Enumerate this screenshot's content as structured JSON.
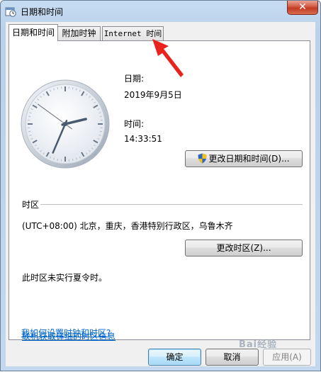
{
  "window": {
    "title": "日期和时间",
    "close_label": "✕"
  },
  "tabs": [
    {
      "label": "日期和时间",
      "active": true
    },
    {
      "label": "附加时钟",
      "active": false
    },
    {
      "label": "Internet 时间",
      "active": false
    }
  ],
  "date": {
    "label": "日期:",
    "value": "2019年9月5日"
  },
  "time": {
    "label": "时间:",
    "value": "14:33:51"
  },
  "clock": {
    "hour": 14,
    "minute": 33,
    "second": 51
  },
  "change_datetime_button": "更改日期和时间(D)...",
  "timezone": {
    "section_label": "时区",
    "value": "(UTC+08:00) 北京，重庆，香港特别行政区，乌鲁木齐",
    "change_button": "更改时区(Z)...",
    "dst_note": "此时区未实行夏令时。"
  },
  "links": {
    "timezone_info": "联机获取详细的时区信息",
    "how_to": "我如何设置时钟和时区?"
  },
  "footer": {
    "ok": "确定",
    "cancel": "取消",
    "apply": "应用(A)"
  },
  "watermark": "Bai经验",
  "colors": {
    "link": "#0066cc",
    "annotation_arrow": "#e8231c"
  }
}
